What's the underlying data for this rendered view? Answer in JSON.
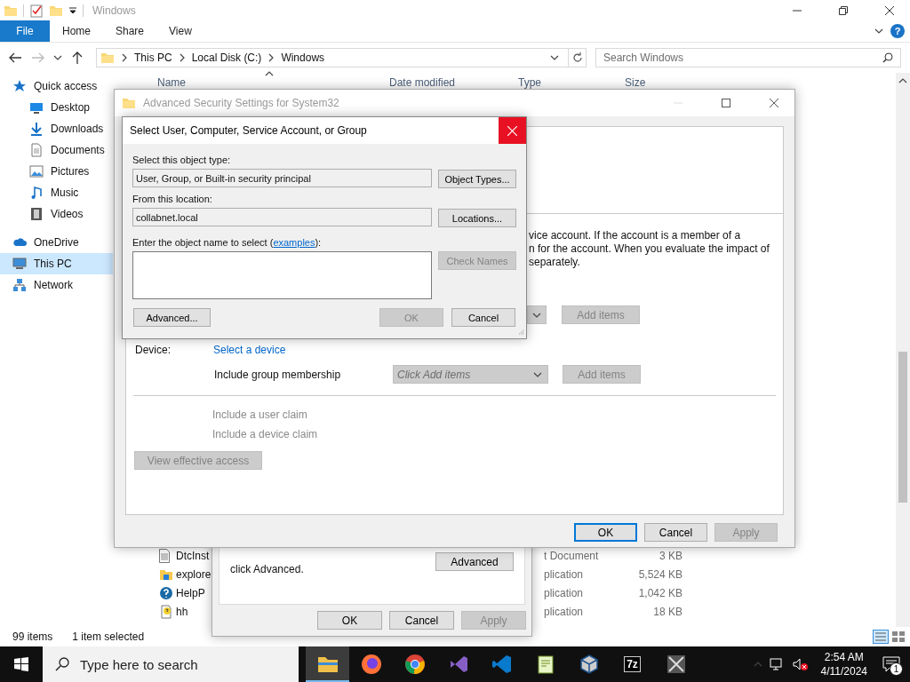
{
  "explorer": {
    "title": "Windows",
    "ribbon": {
      "tabs": [
        {
          "label": "File",
          "selected": true
        },
        {
          "label": "Home",
          "selected": false
        },
        {
          "label": "Share",
          "selected": false
        },
        {
          "label": "View",
          "selected": false
        }
      ],
      "help": "?"
    },
    "address": {
      "path": [
        "This PC",
        "Local Disk (C:)",
        "Windows"
      ],
      "search_placeholder": "Search Windows"
    },
    "columns": [
      "Name",
      "Date modified",
      "Type",
      "Size"
    ],
    "nav": [
      {
        "label": "Quick access",
        "selected": false,
        "children": [
          {
            "label": "Desktop",
            "selected": false
          },
          {
            "label": "Downloads",
            "selected": false
          },
          {
            "label": "Documents",
            "selected": false
          },
          {
            "label": "Pictures",
            "selected": false
          },
          {
            "label": "Music",
            "selected": false
          },
          {
            "label": "Videos",
            "selected": false
          }
        ]
      },
      {
        "label": "OneDrive",
        "selected": false
      },
      {
        "label": "This PC",
        "selected": true
      },
      {
        "label": "Network",
        "selected": false
      }
    ],
    "files": [
      {
        "name": "DtcInst",
        "type": "t Document",
        "size": "3 KB"
      },
      {
        "name": "explore",
        "type": "plication",
        "size": "5,524 KB"
      },
      {
        "name": "HelpP",
        "type": "plication",
        "size": "1,042 KB"
      },
      {
        "name": "hh",
        "type": "plication",
        "size": "18 KB"
      }
    ],
    "status": {
      "count": "99 items",
      "selection": "1 item selected"
    }
  },
  "properties_dialog": {
    "note": "click Advanced.",
    "advanced_button": "Advanced",
    "buttons": [
      {
        "label": "OK",
        "disabled": false
      },
      {
        "label": "Cancel",
        "disabled": false
      },
      {
        "label": "Apply",
        "disabled": true
      }
    ]
  },
  "security_window": {
    "title": "Advanced Security Settings for System32",
    "description": [
      "vice account. If the account is a member of a",
      "n for the account. When you evaluate the impact of",
      "separately."
    ],
    "principal_row": {
      "button": "Add items",
      "disabled": true
    },
    "device": {
      "label": "Device:",
      "link": "Select a device"
    },
    "group_membership": {
      "label": "Include group membership",
      "placeholder": "Click Add items",
      "button": "Add items",
      "disabled": true
    },
    "claims": [
      {
        "label": "Include a user claim",
        "disabled": true
      },
      {
        "label": "Include a device claim",
        "disabled": true
      }
    ],
    "view_access": {
      "label": "View effective access",
      "disabled": true
    },
    "buttons": [
      {
        "label": "OK",
        "disabled": false,
        "default": true
      },
      {
        "label": "Cancel",
        "disabled": false,
        "default": false
      },
      {
        "label": "Apply",
        "disabled": true,
        "default": false
      }
    ]
  },
  "select_dialog": {
    "title": "Select User, Computer, Service Account, or Group",
    "close_hovered": true,
    "object_type": {
      "label": "Select this object type:",
      "value": "User, Group, or Built-in security principal",
      "button": "Object Types..."
    },
    "location": {
      "label": "From this location:",
      "value": "collabnet.local",
      "button": "Locations..."
    },
    "name": {
      "label_start": "Enter the object name to select (",
      "link": "examples",
      "label_end": "):",
      "button": "Check Names",
      "button_disabled": true
    },
    "buttons": [
      {
        "label": "Advanced...",
        "disabled": false
      },
      {
        "label": "OK",
        "disabled": true
      },
      {
        "label": "Cancel",
        "disabled": false
      }
    ]
  },
  "taskbar": {
    "search_placeholder": "Type here to search",
    "apps": [
      {
        "kind": "explorer",
        "active": true
      },
      {
        "kind": "firefox",
        "active": false
      },
      {
        "kind": "chrome",
        "active": false
      },
      {
        "kind": "visual-studio",
        "active": false
      },
      {
        "kind": "vscode",
        "active": false
      },
      {
        "kind": "notepad",
        "active": false
      },
      {
        "kind": "virtualbox",
        "active": false
      },
      {
        "kind": "sevenzip",
        "label": "7z",
        "active": false
      },
      {
        "kind": "tool",
        "active": false
      }
    ],
    "time": "2:54 AM",
    "date": "4/11/2024",
    "notifications": "1"
  }
}
